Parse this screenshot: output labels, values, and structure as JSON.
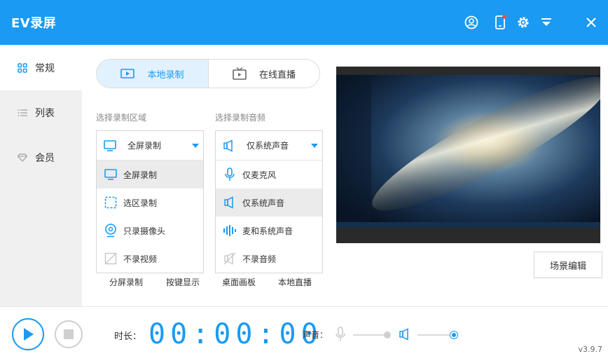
{
  "app": {
    "title": "EV录屏",
    "version": "v3.9.7"
  },
  "titlebar_icons": [
    "user-icon",
    "phone-icon",
    "settings-gear-icon",
    "dropdown-menu-icon",
    "close-icon"
  ],
  "sidebar": {
    "items": [
      {
        "label": "常规",
        "icon": "grid-icon",
        "active": true
      },
      {
        "label": "列表",
        "icon": "list-icon",
        "active": false
      },
      {
        "label": "会员",
        "icon": "diamond-icon",
        "active": false
      }
    ]
  },
  "tabs": [
    {
      "label": "本地录制",
      "icon": "camera-icon",
      "active": true
    },
    {
      "label": "在线直播",
      "icon": "tv-icon",
      "active": false
    }
  ],
  "area_select": {
    "section_label": "选择录制区域",
    "selected": "全屏录制",
    "options": [
      {
        "label": "全屏录制",
        "icon": "monitor-icon",
        "selected": true
      },
      {
        "label": "选区录制",
        "icon": "selection-icon",
        "selected": false
      },
      {
        "label": "只录摄像头",
        "icon": "webcam-icon",
        "selected": false
      },
      {
        "label": "不录视频",
        "icon": "no-video-icon",
        "selected": false
      }
    ]
  },
  "audio_select": {
    "section_label": "选择录制音频",
    "selected": "仅系统声音",
    "options": [
      {
        "label": "仅麦克风",
        "icon": "microphone-icon",
        "selected": false
      },
      {
        "label": "仅系统声音",
        "icon": "speaker-icon",
        "selected": true
      },
      {
        "label": "麦和系统声音",
        "icon": "sound-wave-icon",
        "selected": false
      },
      {
        "label": "不录音频",
        "icon": "no-audio-icon",
        "selected": false
      }
    ]
  },
  "links": [
    "分屏录制",
    "按键显示",
    "桌面画板",
    "本地直播"
  ],
  "scene_edit_label": "场景编辑",
  "bottom": {
    "duration_label": "时长：",
    "timer": "00:00:00",
    "sound_label": "声音：",
    "mic_volume": 0.95,
    "system_volume": 1.0
  },
  "colors": {
    "accent": "#1a9af2",
    "titlebar": "#1a9af2",
    "sidebar": "#f0f0f0"
  }
}
